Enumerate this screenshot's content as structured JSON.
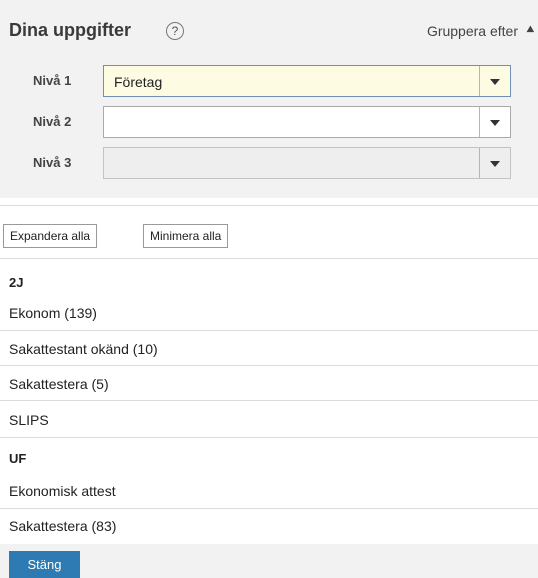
{
  "header": {
    "title": "Dina uppgifter",
    "help_glyph": "?",
    "group_by_label": "Gruppera efter",
    "group_by_icon": "double-chevron-up-icon"
  },
  "levels": [
    {
      "label": "Nivå 1",
      "value": "Företag",
      "state": "active"
    },
    {
      "label": "Nivå 2",
      "value": "",
      "state": "normal"
    },
    {
      "label": "Nivå 3",
      "value": "",
      "state": "disabled"
    }
  ],
  "toolbar": {
    "expand_all": "Expandera alla",
    "collapse_all": "Minimera alla"
  },
  "groups": [
    {
      "name": "2J",
      "items": [
        "Ekonom (139)",
        "Sakattestant okänd (10)",
        "Sakattestera (5)",
        "SLIPS"
      ]
    },
    {
      "name": "UF",
      "items": [
        "Ekonomisk attest",
        "Sakattestera (83)"
      ]
    }
  ],
  "footer": {
    "close_label": "Stäng"
  },
  "colors": {
    "panel_bg": "#f2f2f2",
    "active_field_bg": "#fdfbe2",
    "primary_button": "#2e7ab3"
  }
}
